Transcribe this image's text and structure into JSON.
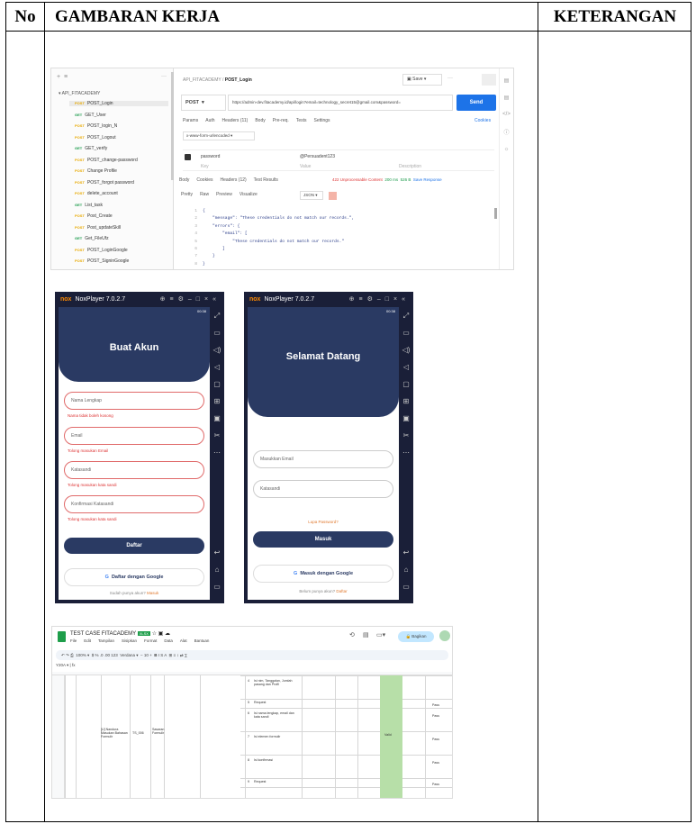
{
  "table": {
    "headers": {
      "no": "No",
      "kerja": "GAMBARAN KERJA",
      "ket": "KETERANGAN"
    }
  },
  "postman": {
    "breadcrumb_collection": "API_FITACADEMY",
    "breadcrumb_request": "POST_Login",
    "save_label": "Save",
    "collection_name": "API_FITACADEMY",
    "sidebar_items": [
      {
        "method": "POST",
        "name": "POST_Login"
      },
      {
        "method": "GET",
        "name": "GET_User"
      },
      {
        "method": "POST",
        "name": "POST_login_N"
      },
      {
        "method": "POST",
        "name": "POST_Logout"
      },
      {
        "method": "GET",
        "name": "GET_verify"
      },
      {
        "method": "POST",
        "name": "POST_change-password"
      },
      {
        "method": "POST",
        "name": "Change Profile"
      },
      {
        "method": "POST",
        "name": "POST_forgot password"
      },
      {
        "method": "POST",
        "name": "delete_account"
      },
      {
        "method": "GET",
        "name": "List_task"
      },
      {
        "method": "POST",
        "name": "Post_Create"
      },
      {
        "method": "POST",
        "name": "Post_updateSkill"
      },
      {
        "method": "GET",
        "name": "Get_FileUfz"
      },
      {
        "method": "POST",
        "name": "POST_LoginGoogle"
      },
      {
        "method": "POST",
        "name": "POST_SigninGoogle"
      }
    ],
    "method": "POST",
    "url": "https://admin-dev.fitacademy.id/api/login?email=technology_secret15@gmail.com&password=",
    "send": "Send",
    "tabs": [
      "Params",
      "Auth",
      "Headers (11)",
      "Body",
      "Pre-req.",
      "Tests",
      "Settings"
    ],
    "cookies": "Cookies",
    "body_type": "x-www-form-urlencoded",
    "row_key": "password",
    "row_value": "@Persuadent123",
    "col_key": "Key",
    "col_value": "Value",
    "col_desc": "Description",
    "resp_tabs": [
      "Body",
      "Cookies",
      "Headers (12)",
      "Test Results"
    ],
    "status": "422 Unprocessable Content",
    "time": "200 ms",
    "size": "526 B",
    "save_response": "Save Response",
    "view_tabs": [
      "Pretty",
      "Raw",
      "Preview",
      "Visualize"
    ],
    "format": "JSON",
    "code_lines": [
      "{",
      "    \"message\": \"These credentials do not match our records.\",",
      "    \"errors\": {",
      "        \"email\": [",
      "            \"These credentials do not match our records.\"",
      "        ]",
      "    }",
      "}"
    ]
  },
  "phone1": {
    "window_title": "NoxPlayer 7.0.2.7",
    "status_time": "00:38",
    "title": "Buat Akun",
    "fields": [
      {
        "placeholder": "Nama Lengkap",
        "error": "Nama tidak boleh kosong"
      },
      {
        "placeholder": "Email",
        "error": "Tolong masukan Email"
      },
      {
        "placeholder": "Katasandi",
        "error": "Tolong masukan kata sandi"
      },
      {
        "placeholder": "Konfirmasi Katasandi",
        "error": "Tolong masukan kata sandi"
      }
    ],
    "button": "Daftar",
    "google": "Daftar dengan Google",
    "footer": "Sudah punya akun?",
    "footer_link": "Masuk"
  },
  "phone2": {
    "window_title": "NoxPlayer 7.0.2.7",
    "status_time": "00:38",
    "title": "Selamat Datang",
    "email_placeholder": "Masukkan Email",
    "pass_placeholder": "Katasandi",
    "forgot": "Lupa Password?",
    "button": "Masuk",
    "google": "Masuk dengan Google",
    "footer": "Belum punya akun?",
    "footer_link": "Daftar"
  },
  "sheet": {
    "title": "TEST CASE FITACADEMY",
    "badge": "XLSX",
    "menu": [
      "File",
      "Edit",
      "Tampilan",
      "Sisipkan",
      "Format",
      "Data",
      "Alat",
      "Bantuan"
    ],
    "share": "Bagikan",
    "cell_ref": "Y20A",
    "zoom": "100%",
    "font": "Verdana",
    "font_size": "10",
    "rows": [
      {
        "step": "4",
        "desc": "Isi nim, Tanggalan, Jumlah pasang dan Profil",
        "status": ""
      },
      {
        "step": "5",
        "desc": "Request",
        "status": "Pass"
      },
      {
        "step": "6",
        "desc": "Isi nama lengkap, email dan kata sandi",
        "status": "Pass"
      },
      {
        "step": "7",
        "desc": "Isi elemen formulir",
        "status": "Pass"
      },
      {
        "step": "8",
        "desc": "Isi konfirmasi",
        "status": "Pass"
      },
      {
        "step": "9",
        "desc": "Request",
        "status": "Pass"
      }
    ],
    "case_title": "[U] Nandura Masukan Bahasan Formulir",
    "case_id": "TS_006",
    "case_type": "Sasaran Formulir",
    "result": "Valid"
  }
}
